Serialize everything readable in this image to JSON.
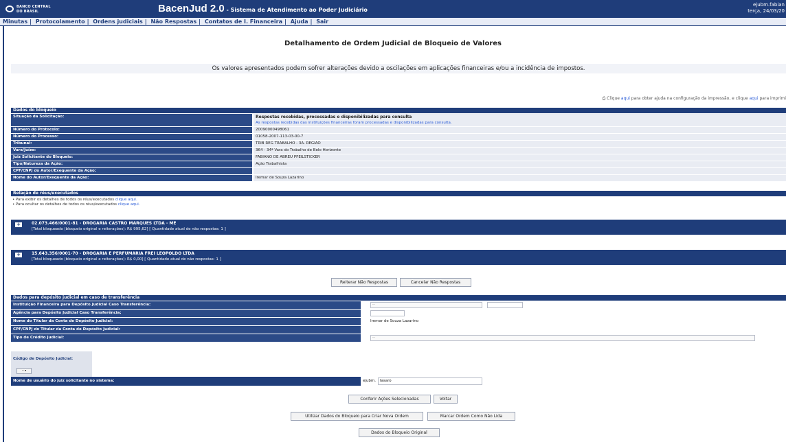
{
  "header": {
    "logo_line1": "BANCO CENTRAL",
    "logo_line2": "DO BRASIL",
    "app_name": "BacenJud 2.0",
    "app_subtitle": " - Sistema de Atendimento ao Poder Judiciário",
    "user": "ejubm.fabian",
    "date": "terça, 24/03/20"
  },
  "menu": [
    "Minutas",
    "Protocolamento",
    "Ordens judiciais",
    "Não Respostas",
    "Contatos de I. Financeira",
    "Ajuda",
    "Sair"
  ],
  "page_title": "Detalhamento de Ordem Judicial de Bloqueio de Valores",
  "notice": "Os valores apresentados podem sofrer alterações devido a oscilações em aplicações financeiras e/ou a incidência de impostos.",
  "print_help": {
    "prefix": "Clique ",
    "link1": "aqui",
    "middle": " para obter ajuda na configuração da impressão, e clique ",
    "link2": "aqui",
    "suffix": " para imprimi"
  },
  "bloqueio": {
    "title": "Dados do bloqueio",
    "situacao_label": "Situação da Solicitação:",
    "situacao_value": "Respostas recebidas, processadas e disponibilizadas para consulta",
    "situacao_detail": "As respostas recebidas das instituições financeiras foram processadas e disponibilizadas para consulta.",
    "rows": [
      {
        "label": "Número do Protocolo:",
        "value": "20090000498061"
      },
      {
        "label": "Número do Processo:",
        "value": "01058-2007-113-03-00-7"
      },
      {
        "label": "Tribunal:",
        "value": "TRIB REG TRABALHO - 3A. REGIAO"
      },
      {
        "label": "Vara/Juízo:",
        "value": "364 - 34ª Vara do Trabalho de Belo Horizonte"
      },
      {
        "label": "Juiz Solicitante do Bloqueio:",
        "value": "FABIANO DE ABREU PFEILSTICKER"
      },
      {
        "label": "Tipo/Natureza da Ação:",
        "value": "Ação Trabalhista"
      },
      {
        "label": "CPF/CNPJ do Autor/Exequente da Ação:",
        "value": ""
      },
      {
        "label": "Nome do Autor/Exequente da Ação:",
        "value": "Iremar de Souza Lazarino"
      }
    ]
  },
  "relacao": {
    "title": "Relação de réus/executados",
    "line1_text": "• Para exibir os detalhes de todos os réus/executados ",
    "line1_link": "clique aqui.",
    "line2_text": "• Para ocultar os detalhes de todos os réus/executados ",
    "line2_link": "clique aqui.",
    "parties": [
      {
        "toggle": "+",
        "name": "02.073.466/0001-81 - DROGARIA CASTRO MARQUES LTDA - ME",
        "total": "[Total bloqueado (bloqueio original e reiterações): R$ 995,62] [ Quantidade atual de não respostas: 1 ]"
      },
      {
        "toggle": "+",
        "name": "15.643.356/0001-70 - DROGARIA E PERFUMARIA FREI LEOPOLDO LTDA",
        "total": "[Total bloqueado (bloqueio original e reiterações): R$ 0,00] [ Quantidade atual de não respostas: 1 ]"
      }
    ]
  },
  "buttons": {
    "reiterar": "Reiterar Não Respostas",
    "cancelar": "Cancelar Não Respostas",
    "conferir": "Conferir Ações Selecionadas",
    "voltar": "Voltar",
    "utilizar": "Utilizar Dados do Bloqueio para Criar Nova Ordem",
    "marcar": "Marcar Ordem Como Não Lida",
    "dados_original": "Dados do Bloqueio Original"
  },
  "deposito": {
    "title": "Dados para depósito judicial em caso de transferência",
    "rows": [
      {
        "label": "Instituição Financeira para Depósito Judicial Caso Transferência:",
        "value": "--"
      },
      {
        "label": "Agência para Depósito Judicial Caso Transferência:",
        "value": ""
      },
      {
        "label": "Nome do Titular da Conta de Depósito Judicial:",
        "value": "Iremar de Souza Lazarino"
      },
      {
        "label": "CPF/CNPJ do Titular da Conta de Depósito Judicial:",
        "value": ""
      },
      {
        "label": "Tipo de Crédito Judicial:",
        "value": "--"
      }
    ],
    "codigo_label": "Código de Depósito Judicial:",
    "codigo_btn": "-- ▾",
    "juiz_label": "Nome de usuário do juiz solicitante no sistema:",
    "juiz_prefix": "ejubm.",
    "juiz_value": "lasaro"
  },
  "colors": {
    "primary": "#1f3d7a",
    "row_label": "#2b4a87",
    "row_value": "#e9ecf3",
    "link": "#2a5bd7"
  }
}
